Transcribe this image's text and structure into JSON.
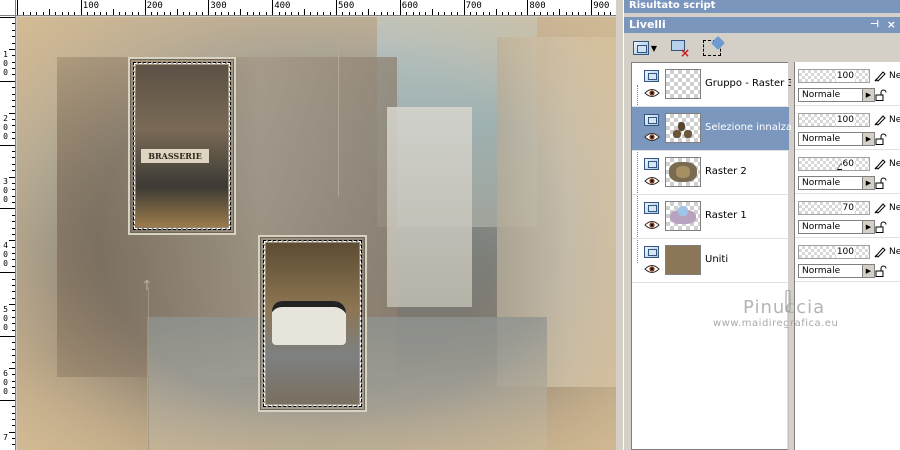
{
  "script_bar": {
    "title": "Risultato script"
  },
  "layers_palette": {
    "title": "Livelli",
    "pin_glyph": "⊣",
    "close_glyph": "×",
    "layers": [
      {
        "name": "Gruppo - Raster 3",
        "selected": false
      },
      {
        "name": "Selezione innalzata",
        "selected": true
      },
      {
        "name": "Raster 2",
        "selected": false
      },
      {
        "name": "Raster 1",
        "selected": false
      },
      {
        "name": "Uniti",
        "selected": false
      }
    ],
    "properties": [
      {
        "opacity": "100",
        "opacity_fraction": 1.0,
        "blend_mode": "Normale",
        "mode_suffix": "Ne"
      },
      {
        "opacity": "100",
        "opacity_fraction": 1.0,
        "blend_mode": "Normale",
        "mode_suffix": "Ne"
      },
      {
        "opacity": "60",
        "opacity_fraction": 0.6,
        "blend_mode": "Normale",
        "mode_suffix": "Ne"
      },
      {
        "opacity": "70",
        "opacity_fraction": 0.7,
        "blend_mode": "Normale",
        "mode_suffix": "Ne"
      },
      {
        "opacity": "100",
        "opacity_fraction": 1.0,
        "blend_mode": "Normale",
        "mode_suffix": "Ne"
      }
    ]
  },
  "rulers": {
    "top_labels": [
      "100",
      "200",
      "300",
      "400",
      "500",
      "600",
      "700",
      "800",
      "900"
    ],
    "left_labels": [
      "1",
      "0",
      "0",
      "2",
      "0",
      "0",
      "3",
      "0",
      "0",
      "4",
      "0",
      "0",
      "5",
      "0",
      "0",
      "6",
      "0",
      "0",
      "7"
    ]
  },
  "canvas": {
    "sign_text": "BRASSERIE"
  },
  "watermark": {
    "name": "Pinuccia",
    "url": "www.maidiregrafica.eu"
  },
  "colors": {
    "title_bar": "#7a96bd",
    "selected_row": "#7b97be",
    "panel": "#d4d0c8"
  },
  "icons": {
    "new_layer": "new-layer-icon",
    "delete_layer": "delete-layer-icon",
    "mask": "selection-mask-icon",
    "visibility": "eye-icon",
    "layer_type": "raster-layer-icon",
    "brush": "brush-icon",
    "lock": "lock-icon"
  }
}
